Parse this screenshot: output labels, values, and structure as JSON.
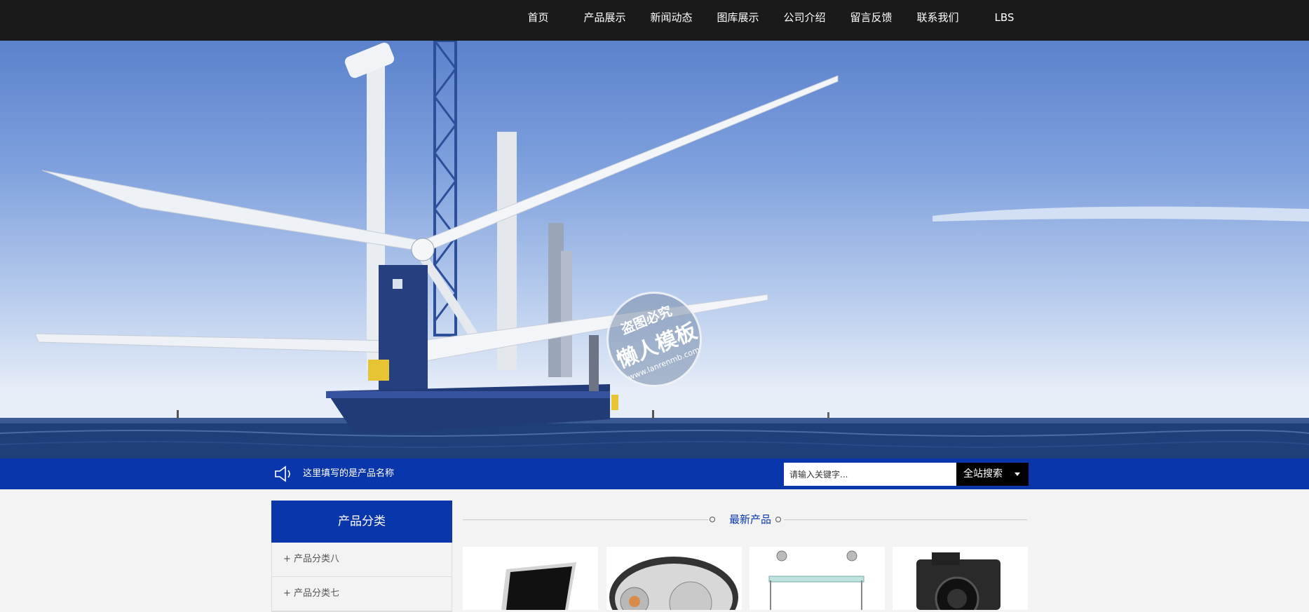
{
  "nav": {
    "items": [
      "首页",
      "产品展示",
      "新闻动态",
      "图库展示",
      "公司介绍",
      "留言反馈",
      "联系我们",
      "LBS"
    ]
  },
  "watermark": {
    "line1": "盗图必究",
    "line2": "懒人模板",
    "line3": "www.lanrenmb.com"
  },
  "strip": {
    "notice": "这里填写的是产品名称",
    "search_placeholder": "请输入关键字...",
    "search_button": "全站搜索"
  },
  "sidebar": {
    "title": "产品分类",
    "items": [
      "+ 产品分类八",
      "+ 产品分类七"
    ]
  },
  "latest": {
    "title": "最新产品"
  },
  "colors": {
    "nav_bg": "#1a1a1a",
    "brand_blue": "#0a36ab",
    "page_bg": "#f3f3f3"
  },
  "icons": [
    "speaker-icon",
    "chevron-down-icon"
  ]
}
